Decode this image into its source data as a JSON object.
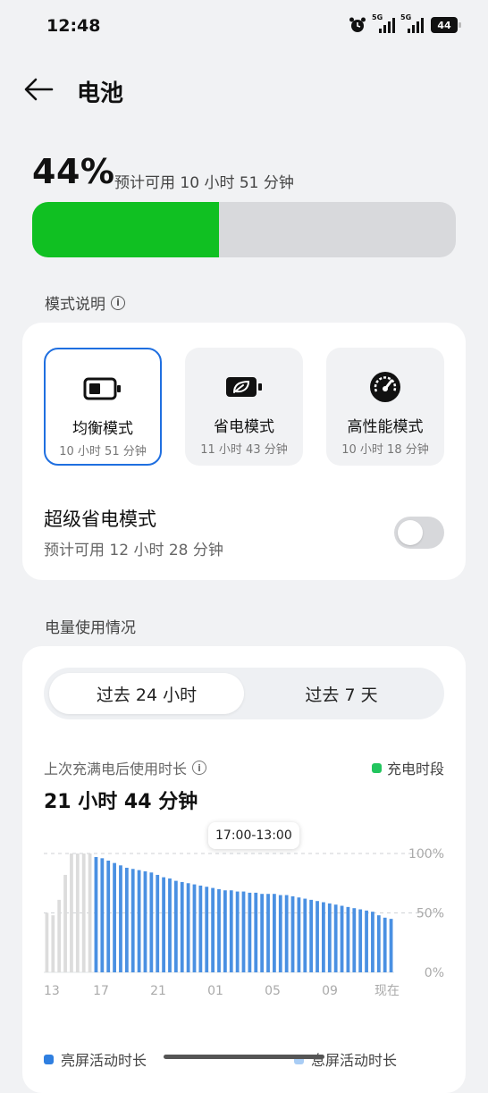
{
  "status": {
    "time": "12:48",
    "battery": "44",
    "net1": "5G",
    "net2": "5G"
  },
  "header": {
    "title": "电池"
  },
  "battery": {
    "percent": "44%",
    "estimate": "预计可用 10 小时 51 分钟",
    "level": 0.44
  },
  "modes": {
    "section_label": "模式说明",
    "items": [
      {
        "name": "均衡模式",
        "time": "10 小时 51 分钟",
        "icon": "battery-icon",
        "selected": true
      },
      {
        "name": "省电模式",
        "time": "11 小时 43 分钟",
        "icon": "leaf-battery-icon",
        "selected": false
      },
      {
        "name": "高性能模式",
        "time": "10 小时 18 分钟",
        "icon": "speedometer-icon",
        "selected": false
      }
    ],
    "super_saver": {
      "title": "超级省电模式",
      "subtitle": "预计可用 12 小时 28 分钟",
      "enabled": false
    }
  },
  "usage": {
    "section_label": "电量使用情况",
    "tabs": [
      "过去 24 小时",
      "过去 7 天"
    ],
    "active_tab": 0,
    "since_label": "上次充满电后使用时长",
    "since_value": "21 小时 44 分钟",
    "charge_legend": "充电时段",
    "tooltip": "17:00-13:00",
    "legend_screen_on": "亮屏活动时长",
    "legend_screen_off": "息屏活动时长",
    "colors": {
      "bar": "#4a90e2",
      "charging_bar": "#dcdcdc",
      "charge_legend": "#22c55e",
      "screen_on": "#2f7fe0",
      "screen_off": "#a9cdf5"
    }
  },
  "chart_data": {
    "type": "bar",
    "x_tick_labels": [
      "13",
      "17",
      "21",
      "01",
      "05",
      "09",
      "现在"
    ],
    "y_tick_labels": [
      "100%",
      "50%",
      "0%"
    ],
    "ylim": [
      0,
      100
    ],
    "grid": true,
    "series": [
      {
        "name": "充电时段",
        "values": [
          50,
          48,
          61,
          82,
          100,
          100,
          100,
          100
        ]
      },
      {
        "values": [
          97,
          96,
          94,
          92,
          90,
          88,
          87,
          86,
          85,
          84,
          82,
          80,
          79,
          77,
          76,
          75,
          74,
          73,
          72,
          71,
          70,
          69,
          69,
          68,
          68,
          67,
          67,
          66,
          66,
          66,
          65,
          65,
          64,
          63,
          62,
          61,
          60,
          59,
          58,
          57,
          56,
          55,
          54,
          53,
          52,
          51,
          48,
          46,
          45
        ]
      }
    ]
  }
}
